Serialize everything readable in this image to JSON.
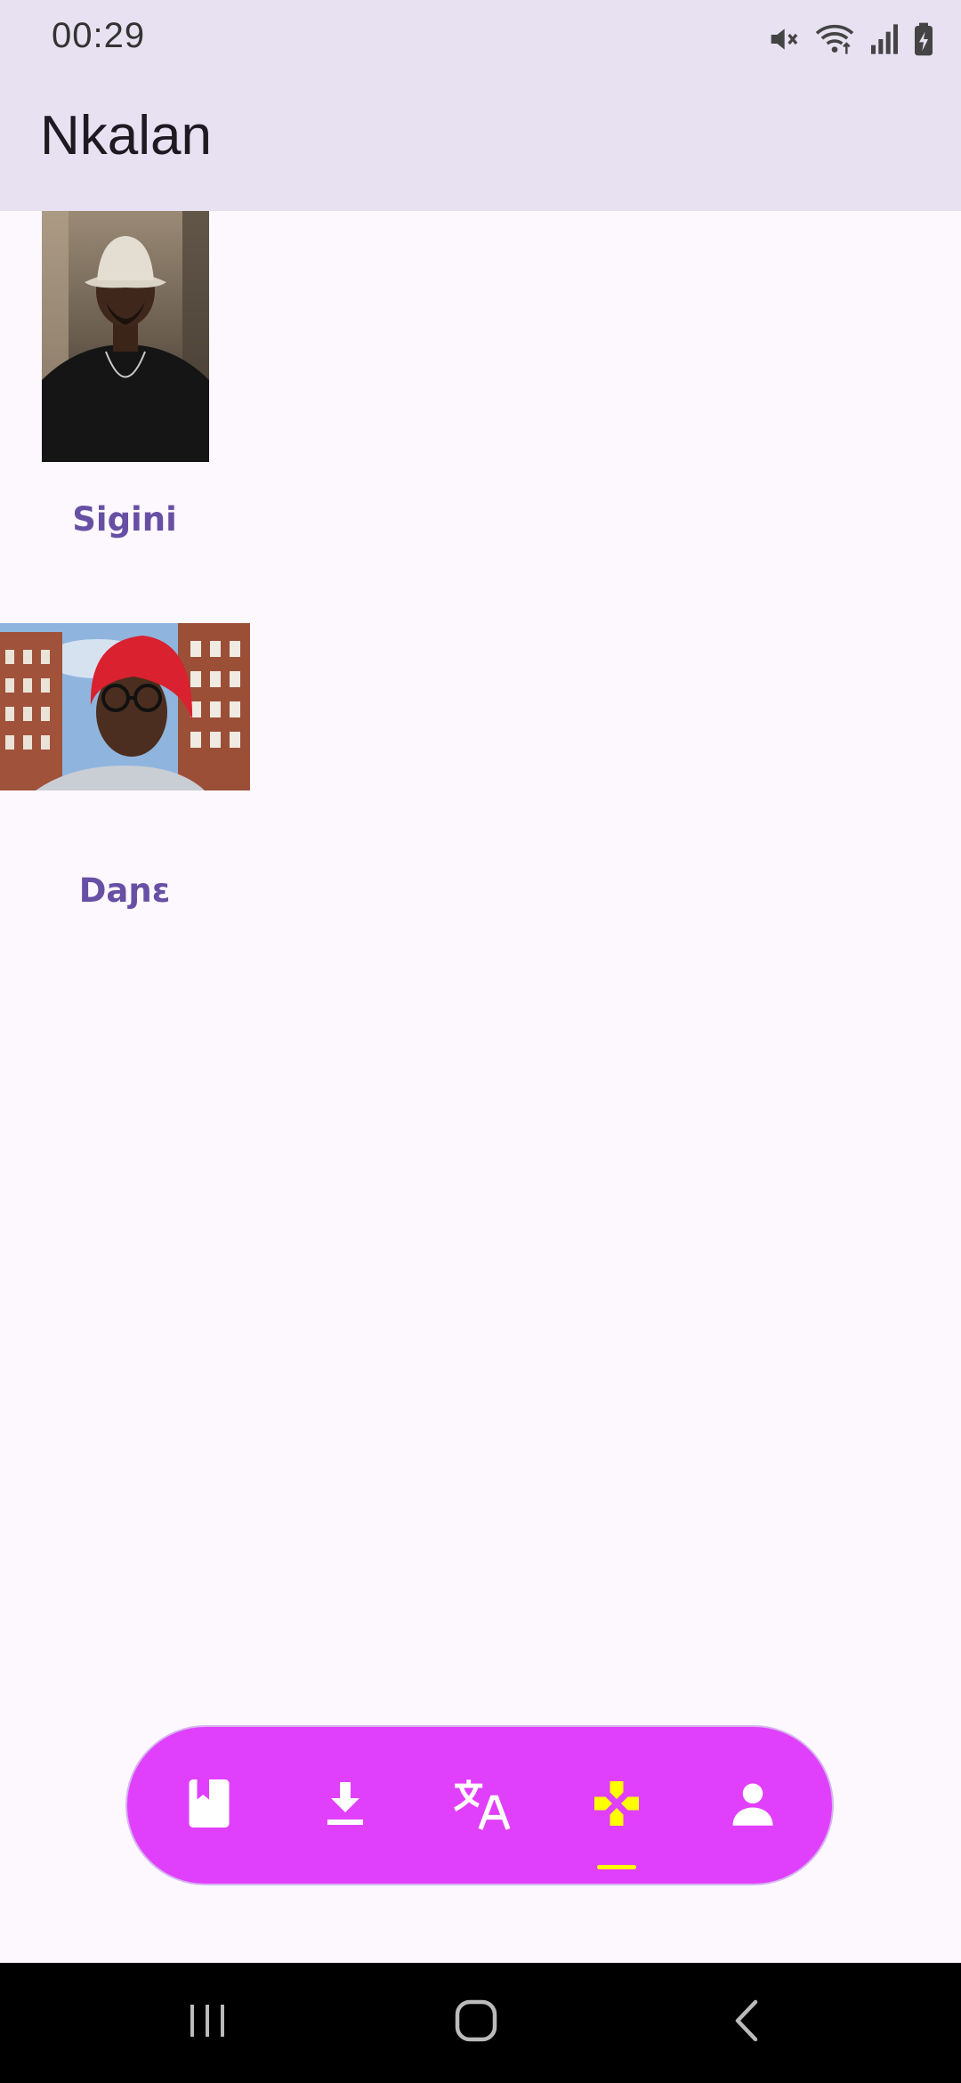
{
  "status_bar": {
    "time": "00:29",
    "icons": [
      "mute-icon",
      "wifi-icon",
      "signal-icon",
      "battery-charging-icon"
    ]
  },
  "app_bar": {
    "title": "Nkalan"
  },
  "cards": [
    {
      "label": "Sigini",
      "image": "man-in-bucket-hat-photo"
    },
    {
      "label": "Daɲɛ",
      "image": "man-in-red-cap-photo"
    }
  ],
  "bottom_nav": {
    "items": [
      {
        "icon": "book-bookmark-icon",
        "selected": false
      },
      {
        "icon": "download-icon",
        "selected": false
      },
      {
        "icon": "translate-icon",
        "selected": false
      },
      {
        "icon": "gamepad-icon",
        "selected": true
      },
      {
        "icon": "person-icon",
        "selected": false
      }
    ],
    "colors": {
      "background": "#E040FB",
      "icon": "#FFFFFF",
      "selected": "#FFFF00"
    }
  },
  "system_nav": {
    "buttons": [
      "recent-apps-icon",
      "home-icon",
      "back-icon"
    ]
  }
}
